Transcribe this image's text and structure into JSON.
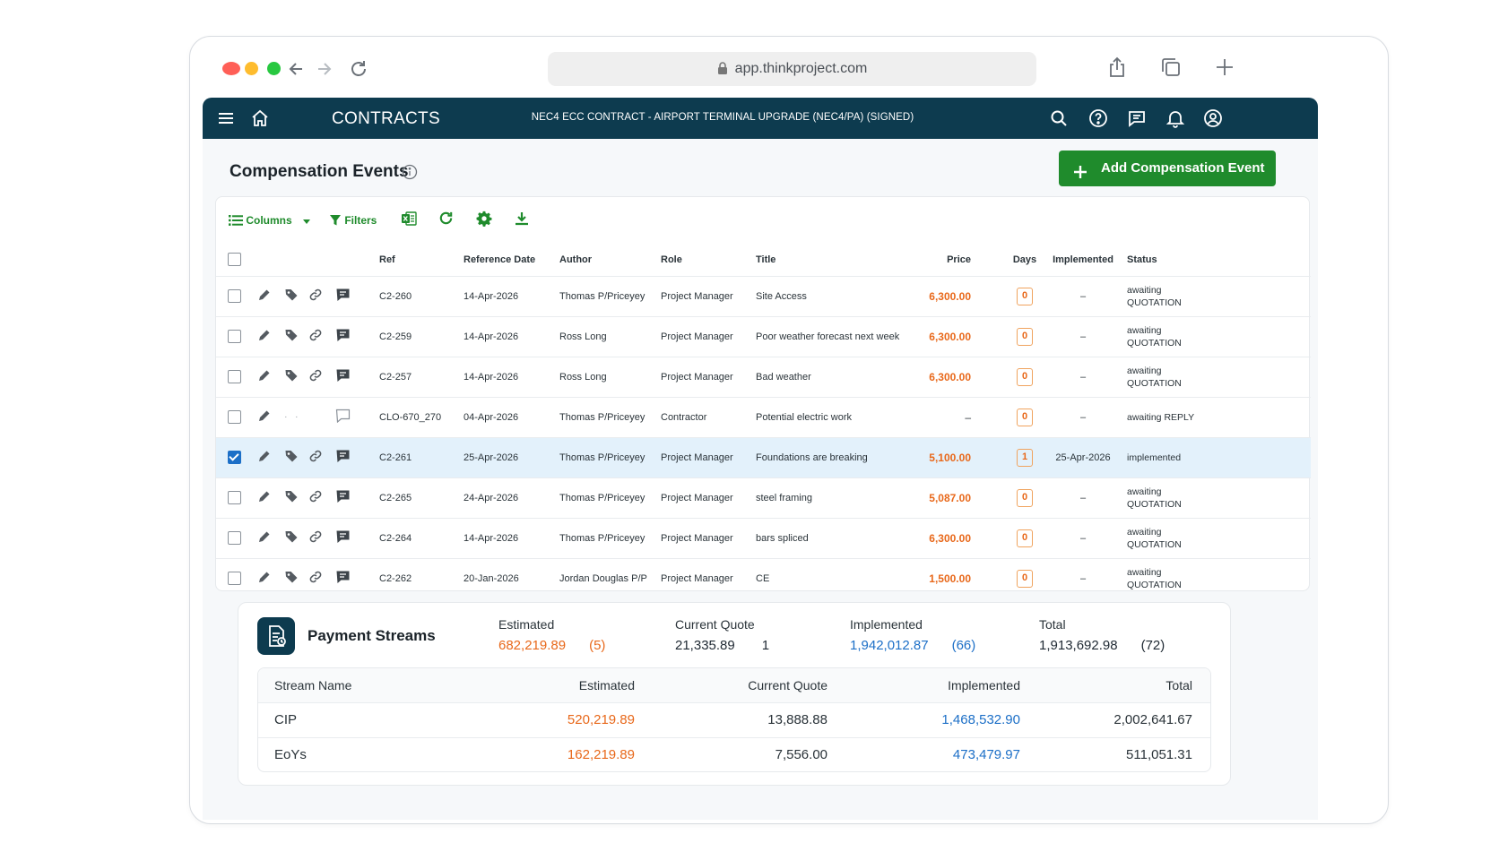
{
  "browser": {
    "url": "app.thinkproject.com"
  },
  "app": {
    "module": "CONTRACTS",
    "contract": "NEC4 ECC CONTRACT - AIRPORT TERMINAL UPGRADE (NEC4/PA) (SIGNED)"
  },
  "page": {
    "title": "Compensation Events",
    "add_button": "Add Compensation Event"
  },
  "toolbar": {
    "columns": "Columns",
    "filters": "Filters"
  },
  "columns": {
    "ref": "Ref",
    "date": "Reference Date",
    "author": "Author",
    "role": "Role",
    "title": "Title",
    "price": "Price",
    "days": "Days",
    "implemented": "Implemented",
    "status": "Status"
  },
  "rows": [
    {
      "ref": "C2-260",
      "date": "14-Apr-2026",
      "author": "Thomas P/Priceyey",
      "role": "Project Manager",
      "title": "Site Access",
      "price": "6,300.00",
      "days": "0",
      "implemented": "–",
      "status1": "awaiting",
      "status2": "QUOTATION"
    },
    {
      "ref": "C2-259",
      "date": "14-Apr-2026",
      "author": "Ross Long",
      "role": "Project Manager",
      "title": "Poor weather forecast next week",
      "price": "6,300.00",
      "days": "0",
      "implemented": "–",
      "status1": "awaiting",
      "status2": "QUOTATION"
    },
    {
      "ref": "C2-257",
      "date": "14-Apr-2026",
      "author": "Ross Long",
      "role": "Project Manager",
      "title": "Bad weather",
      "price": "6,300.00",
      "days": "0",
      "implemented": "–",
      "status1": "awaiting",
      "status2": "QUOTATION"
    },
    {
      "ref": "CLO-670_270",
      "date": "04-Apr-2026",
      "author": "Thomas P/Priceyey",
      "role": "Contractor",
      "title": "Potential electric work",
      "price": "–",
      "days": "0",
      "implemented": "–",
      "status1": "awaiting REPLY",
      "status2": ""
    },
    {
      "ref": "C2-261",
      "date": "25-Apr-2026",
      "author": "Thomas P/Priceyey",
      "role": "Project Manager",
      "title": "Foundations are breaking",
      "price": "5,100.00",
      "days": "1",
      "implemented": "25-Apr-2026",
      "status1": "implemented",
      "status2": ""
    },
    {
      "ref": "C2-265",
      "date": "24-Apr-2026",
      "author": "Thomas P/Priceyey",
      "role": "Project Manager",
      "title": "steel framing",
      "price": "5,087.00",
      "days": "0",
      "implemented": "–",
      "status1": "awaiting",
      "status2": "QUOTATION"
    },
    {
      "ref": "C2-264",
      "date": "14-Apr-2026",
      "author": "Thomas P/Priceyey",
      "role": "Project Manager",
      "title": "bars spliced",
      "price": "6,300.00",
      "days": "0",
      "implemented": "–",
      "status1": "awaiting",
      "status2": "QUOTATION"
    },
    {
      "ref": "C2-262",
      "date": "20-Jan-2026",
      "author": "Jordan Douglas P/P",
      "role": "Project Manager",
      "title": "CE",
      "price": "1,500.00",
      "days": "0",
      "implemented": "–",
      "status1": "awaiting",
      "status2": "QUOTATION"
    }
  ],
  "payment": {
    "title": "Payment Streams",
    "estimated_label": "Estimated",
    "estimated_value": "682,219.89",
    "estimated_count": "(5)",
    "quote_label": "Current Quote",
    "quote_value": "21,335.89",
    "quote_count": "1",
    "implemented_label": "Implemented",
    "implemented_value": "1,942,012.87",
    "implemented_count": "(66)",
    "total_label": "Total",
    "total_value": "1,913,692.98",
    "total_count": "(72)",
    "headers": {
      "name": "Stream Name",
      "estimated": "Estimated",
      "quote": "Current Quote",
      "implemented": "Implemented",
      "total": "Total"
    },
    "streams": [
      {
        "name": "CIP",
        "estimated": "520,219.89",
        "quote": "13,888.88",
        "implemented": "1,468,532.90",
        "total": "2,002,641.67"
      },
      {
        "name": "EoYs",
        "estimated": "162,219.89",
        "quote": "7,556.00",
        "implemented": "473,479.97",
        "total": "511,051.31"
      }
    ]
  }
}
